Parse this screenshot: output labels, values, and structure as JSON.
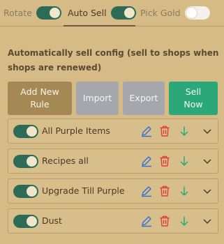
{
  "tabs": [
    {
      "label": "Rotate",
      "toggle": "on"
    },
    {
      "label": "Auto Sell",
      "toggle": "on"
    },
    {
      "label": "Pick Gold",
      "toggle": "off"
    }
  ],
  "heading": "Automatically sell config (sell to shops when shops are renewed)",
  "buttons": {
    "add_new_rule": "Add New Rule",
    "import": "Import",
    "export": "Export",
    "sell_now": "Sell Now"
  },
  "rules": [
    {
      "name": "All Purple Items",
      "enabled": true
    },
    {
      "name": "Recipes all",
      "enabled": true
    },
    {
      "name": "Upgrade Till Purple",
      "enabled": true
    },
    {
      "name": "Dust",
      "enabled": true
    }
  ],
  "colors": {
    "background": "#d6bb86",
    "toggle_on": "#2e6b57",
    "add_button": "#a48954",
    "neutral_button": "#a5a7ad",
    "sell_button": "#2ba877",
    "edit_icon": "#2f6fd6",
    "delete_icon": "#e23b3b",
    "down_icon": "#2ba877"
  },
  "icons": {
    "edit": "pencil-icon",
    "delete": "trash-icon",
    "move_down": "arrow-down-icon",
    "expand": "chevron-down-icon"
  }
}
